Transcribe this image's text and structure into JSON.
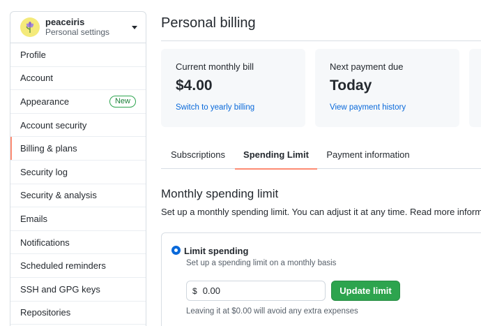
{
  "account": {
    "username": "peaceiris",
    "subtitle": "Personal settings",
    "avatar_icon": "flower-icon"
  },
  "sidebar": {
    "items": [
      {
        "label": "Profile"
      },
      {
        "label": "Account"
      },
      {
        "label": "Appearance",
        "badge": "New"
      },
      {
        "label": "Account security"
      },
      {
        "label": "Billing & plans",
        "active": true
      },
      {
        "label": "Security log"
      },
      {
        "label": "Security & analysis"
      },
      {
        "label": "Emails"
      },
      {
        "label": "Notifications"
      },
      {
        "label": "Scheduled reminders"
      },
      {
        "label": "SSH and GPG keys"
      },
      {
        "label": "Repositories"
      }
    ]
  },
  "page": {
    "title": "Personal billing"
  },
  "cards": [
    {
      "label": "Current monthly bill",
      "value": "$4.00",
      "link": "Switch to yearly billing"
    },
    {
      "label": "Next payment due",
      "value": "Today",
      "link": "View payment history"
    }
  ],
  "tabs": [
    {
      "label": "Subscriptions"
    },
    {
      "label": "Spending Limit",
      "selected": true
    },
    {
      "label": "Payment information"
    }
  ],
  "spending": {
    "title": "Monthly spending limit",
    "description": "Set up a monthly spending limit. You can adjust it at any time. Read more information",
    "option_label": "Limit spending",
    "option_note": "Set up a spending limit on a monthly basis",
    "currency": "$",
    "amount_value": "0.00",
    "update_label": "Update limit",
    "help_note": "Leaving it at $0.00 will avoid any extra expenses"
  },
  "colors": {
    "accent_link": "#0969da",
    "active_indicator": "#fd8c73",
    "primary_button": "#2da44e",
    "badge_green": "#1a7f37",
    "card_background": "#f6f8fa"
  }
}
